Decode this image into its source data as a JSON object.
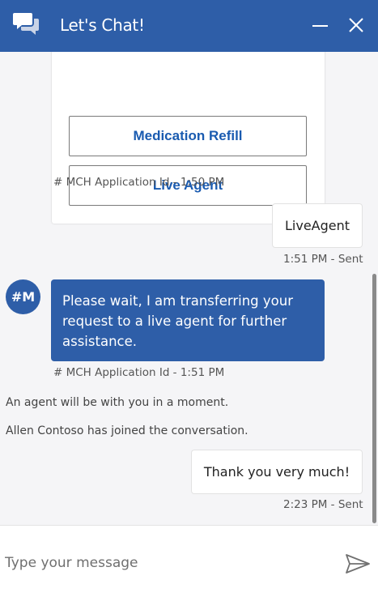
{
  "header": {
    "title": "Let's Chat!",
    "icon": "chat-bubbles-icon",
    "minimize_icon": "minimize-icon",
    "close_icon": "close-icon"
  },
  "transcript": {
    "card": {
      "buttons": [
        {
          "label": "Medication Refill"
        },
        {
          "label": "Live Agent"
        }
      ],
      "meta": "# MCH Application Id - 1:50 PM"
    },
    "messages": [
      {
        "from": "user",
        "text": "LiveAgent",
        "meta": "1:51 PM - Sent"
      },
      {
        "from": "bot",
        "avatar": "#M",
        "text": "Please wait, I am transferring your request to a live agent for further assistance.",
        "meta": "# MCH Application Id - 1:51 PM"
      },
      {
        "from": "user",
        "text": "Thank you very much!",
        "meta": "2:23 PM - Sent"
      }
    ],
    "system": [
      "An agent will be with you in a moment.",
      "Allen Contoso has joined the conversation."
    ]
  },
  "composer": {
    "placeholder": "Type your message",
    "send_icon": "send-icon"
  },
  "colors": {
    "brand": "#2e5ea8",
    "button_text": "#1a5bb0",
    "transcript_bg": "#f5f5f7"
  }
}
